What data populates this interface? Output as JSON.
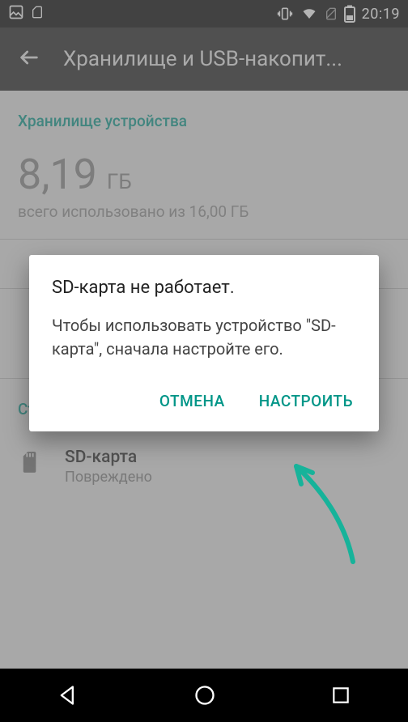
{
  "status": {
    "clock": "20:19"
  },
  "appbar": {
    "title": "Хранилище и USB-накопит..."
  },
  "sections": {
    "device_storage_title": "Хранилище устройства",
    "removable_title": "Съемный накопитель"
  },
  "storage": {
    "used_value": "8,19",
    "unit": "ГБ",
    "subtitle": "всего использовано из 16,00  ГБ"
  },
  "sd_item": {
    "primary": "SD-карта",
    "secondary": "Повреждено"
  },
  "dialog": {
    "title": "SD-карта не работает.",
    "message": "Чтобы использовать устройство \"SD-карта\", сначала настройте его.",
    "cancel": "ОТМЕНА",
    "configure": "НАСТРОИТЬ"
  }
}
